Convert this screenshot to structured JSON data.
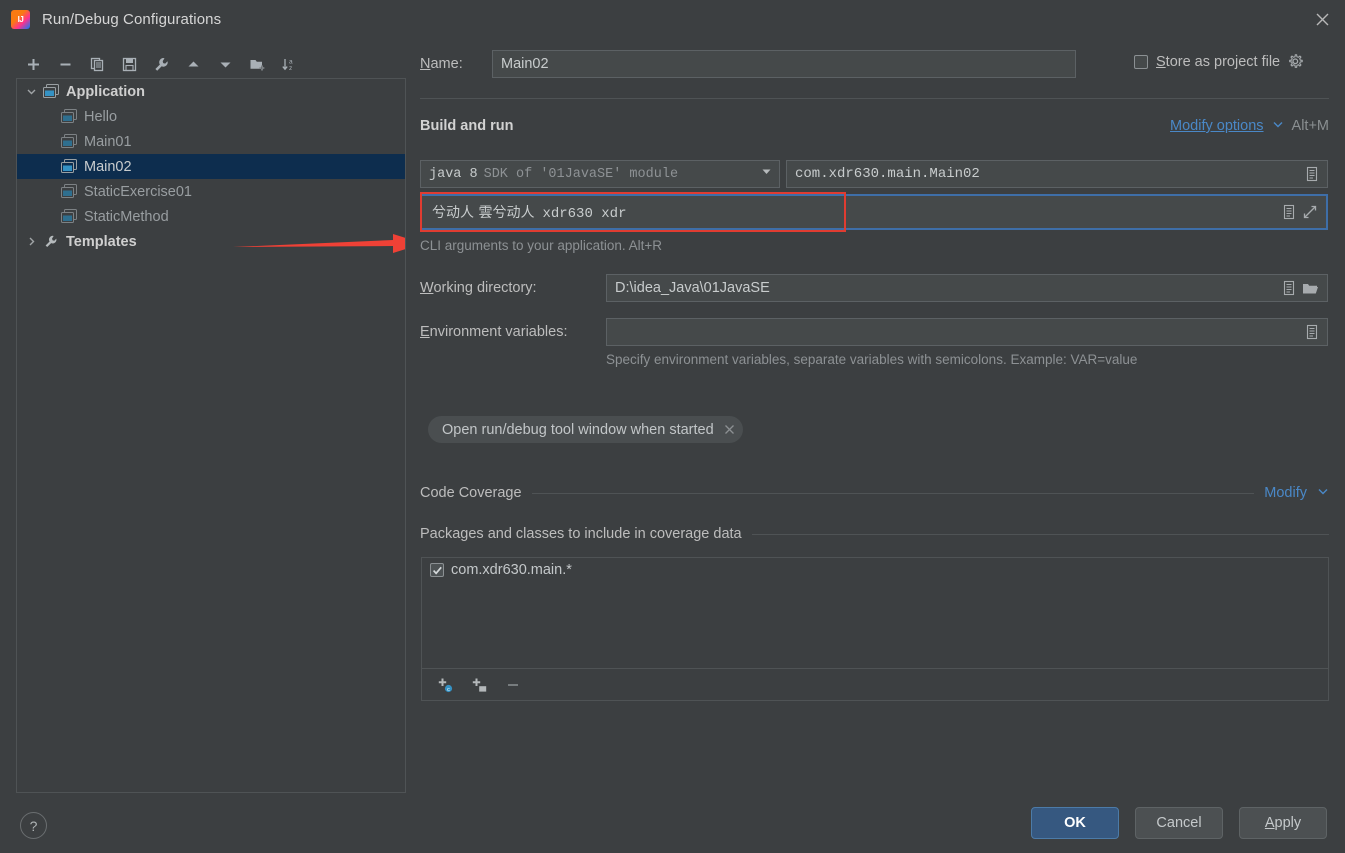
{
  "window": {
    "title": "Run/Debug Configurations",
    "app_icon": "intellij-idea-icon",
    "close_icon": "close-icon"
  },
  "toolbar": {
    "buttons": [
      {
        "name": "add-configuration-button",
        "icon": "plus-icon",
        "tooltip": "Add New Configuration"
      },
      {
        "name": "remove-configuration-button",
        "icon": "minus-icon",
        "tooltip": "Remove Configuration"
      },
      {
        "name": "copy-configuration-button",
        "icon": "copy-icon",
        "tooltip": "Copy Configuration"
      },
      {
        "name": "save-configuration-button",
        "icon": "save-icon",
        "tooltip": "Save Configuration"
      },
      {
        "name": "edit-templates-button",
        "icon": "wrench-icon",
        "tooltip": "Edit Templates"
      },
      {
        "name": "move-up-button",
        "icon": "arrow-up-icon",
        "tooltip": "Move Up"
      },
      {
        "name": "move-down-button",
        "icon": "arrow-down-icon",
        "tooltip": "Move Down"
      },
      {
        "name": "new-folder-button",
        "icon": "folder-add-icon",
        "tooltip": "Create New Folder"
      },
      {
        "name": "sort-button",
        "icon": "sort-az-icon",
        "tooltip": "Sort Configurations"
      }
    ]
  },
  "tree": {
    "nodes": [
      {
        "label": "Application",
        "type": "group",
        "expanded": true,
        "icon": "application-icon",
        "selected": false
      },
      {
        "label": "Hello",
        "type": "leaf",
        "icon": "application-icon",
        "selected": false
      },
      {
        "label": "Main01",
        "type": "leaf",
        "icon": "application-icon",
        "selected": false
      },
      {
        "label": "Main02",
        "type": "leaf",
        "icon": "application-icon",
        "selected": true
      },
      {
        "label": "StaticExercise01",
        "type": "leaf",
        "icon": "application-icon",
        "selected": false
      },
      {
        "label": "StaticMethod",
        "type": "leaf",
        "icon": "application-icon",
        "selected": false
      },
      {
        "label": "Templates",
        "type": "group",
        "expanded": false,
        "icon": "wrench-icon",
        "selected": false
      }
    ]
  },
  "annotation": {
    "arrow_color": "#ee4444",
    "name": "red-arrow-annotation",
    "highlight_color": "#e03c31"
  },
  "help_button": {
    "label": "?",
    "name": "help-button"
  },
  "form": {
    "name_label": "Name:",
    "name_label_mnemonic": "N",
    "name_value": "Main02",
    "store_as_project_file": {
      "label": "Store as project file",
      "mnemonic": "S",
      "checked": false,
      "gear_icon": "gear-icon"
    },
    "build_and_run": {
      "section_title": "Build and run",
      "modify_options_label": "Modify options",
      "modify_options_shortcut": "Alt+M",
      "jre_combo_value": "java 8",
      "jre_combo_suffix": "SDK of '01JavaSE' module",
      "main_class_value": "com.xdr630.main.Main02",
      "main_class_browse_icon": "document-browse-icon",
      "program_arguments_value": "兮动人 雲兮动人 xdr630 xdr",
      "program_arguments_cjk": "兮动人 雲兮动人",
      "program_arguments_ascii": "xdr630 xdr",
      "program_arguments_hint": "CLI arguments to your application. Alt+R",
      "program_arguments_icons": [
        "document-browse-icon",
        "expand-icon"
      ]
    },
    "working_directory": {
      "label": "Working directory:",
      "mnemonic": "W",
      "value": "D:\\idea_Java\\01JavaSE",
      "icons": [
        "document-browse-icon",
        "folder-open-icon"
      ]
    },
    "environment_variables": {
      "label": "Environment variables:",
      "mnemonic": "E",
      "value": "",
      "hint": "Specify environment variables, separate variables with semicolons. Example: VAR=value",
      "icons": [
        "document-browse-icon"
      ]
    },
    "option_chips": [
      {
        "label": "Open run/debug tool window when started",
        "close_icon": "chip-close-icon"
      }
    ],
    "code_coverage": {
      "section_title": "Code Coverage",
      "modify_label": "Modify",
      "modify_caret": "chevron-down-icon",
      "packages_title": "Packages and classes to include in coverage data",
      "items": [
        {
          "label": "com.xdr630.main.*",
          "checked": true
        }
      ],
      "list_toolbar": [
        {
          "name": "add-class-button",
          "icon": "plus-class-icon"
        },
        {
          "name": "add-package-button",
          "icon": "plus-package-icon"
        },
        {
          "name": "remove-pattern-button",
          "icon": "minus-icon"
        }
      ]
    }
  },
  "footer": {
    "ok_label": "OK",
    "cancel_label": "Cancel",
    "apply_label": "Apply",
    "apply_mnemonic": "A"
  },
  "colors": {
    "dialog_bg": "#3c3f41",
    "field_bg": "#45494a",
    "selection_bg": "#0d2d4e",
    "link": "#4a88c7",
    "primary_button": "#365880",
    "annotation_red": "#e03c31",
    "focus_border": "#3e6ea8"
  }
}
